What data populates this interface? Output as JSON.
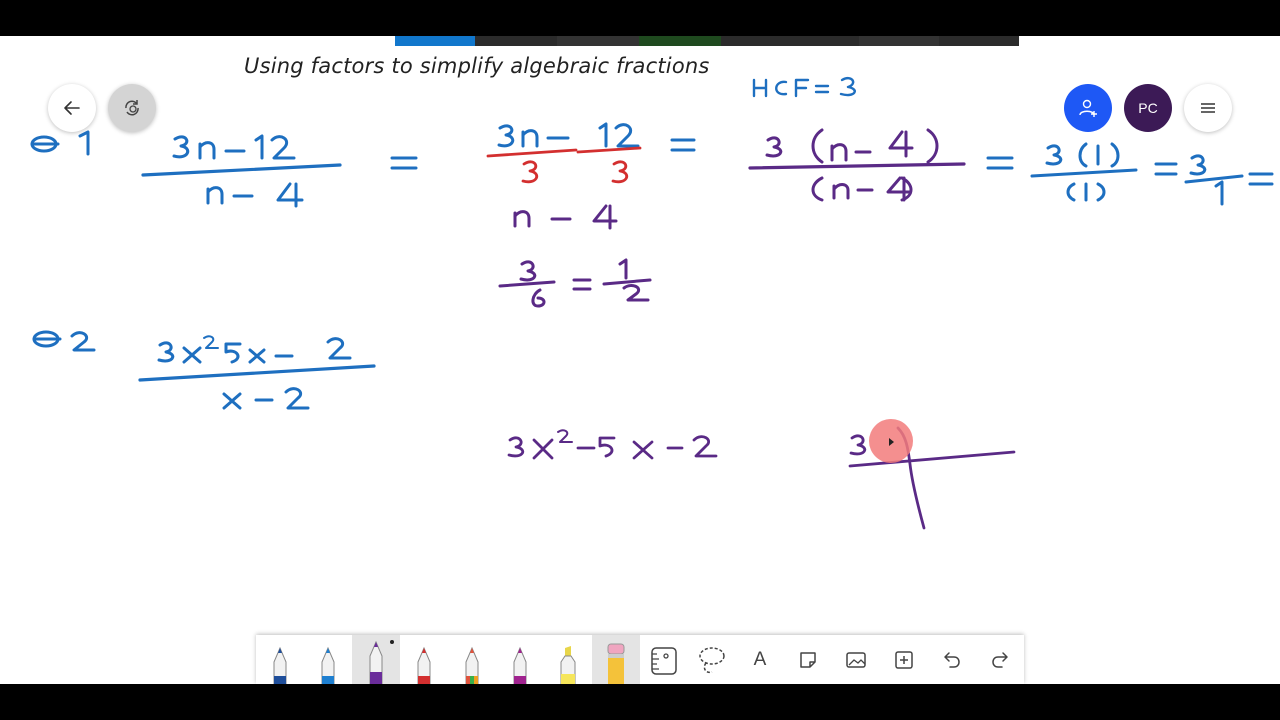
{
  "title": "Using factors to simplify algebraic fractions",
  "buttons": {
    "avatar_initials": "PC"
  },
  "pens": [
    {
      "name": "pen-dark-blue",
      "color": "#1f4e9a"
    },
    {
      "name": "pen-blue",
      "color": "#1e7fd0"
    },
    {
      "name": "pen-purple",
      "color": "#6a2c9a",
      "selected": true
    },
    {
      "name": "pen-red",
      "color": "#d32f2f"
    },
    {
      "name": "pen-multicolor",
      "color": "#e0533c"
    },
    {
      "name": "pen-magenta",
      "color": "#a0238f"
    },
    {
      "name": "highlighter-yellow",
      "color": "#f6e65b"
    },
    {
      "name": "pencil",
      "color": "#f4c23a"
    }
  ],
  "tools": {
    "text_tool": "A"
  },
  "ink_colors": {
    "blue": "#1e6fc0",
    "red": "#d32f2f",
    "purple": "#5a2a86",
    "pointer": "#f27b7b"
  }
}
